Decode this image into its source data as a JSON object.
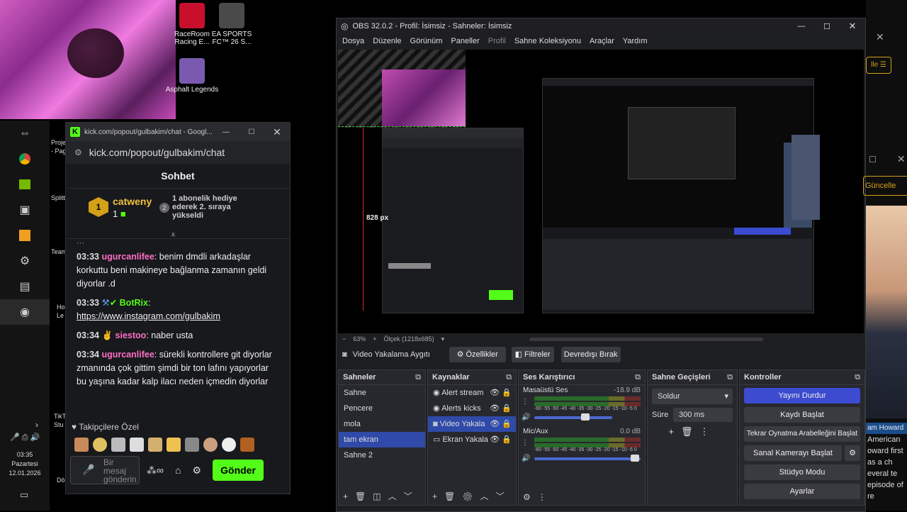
{
  "desktop": {
    "icons": [
      {
        "label": "RaceRoom Racing E...",
        "color": "#c8102e"
      },
      {
        "label": "EA SPORTS FC™ 26 S...",
        "color": "#4a4a4a"
      },
      {
        "label": "Asphalt Legends",
        "color": "#7a5ab0"
      }
    ],
    "partial_labels": [
      "Proje",
      "- Pag",
      "Splitt",
      "Team",
      "Ho",
      "Le",
      "TikT",
      "Stu",
      "Dö"
    ],
    "clock": {
      "time": "03:35",
      "day": "Pazartesi",
      "date": "12.01.2026"
    }
  },
  "kick": {
    "title": "kick.com/popout/gulbakim/chat - Googl...",
    "url": "kick.com/popout/gulbakim/chat",
    "header": "Sohbet",
    "pinned": {
      "user": "catweny",
      "count": "1",
      "message": "1 abonelik hediye ederek 2. sıraya yükseldi"
    },
    "messages": [
      {
        "time": "03:33",
        "user": "ugurcanlifee",
        "text": ": benim dmdli arkadaşlar korkuttu beni makineye bağlanma zamanın geldi diyorlar .d",
        "style": "pink"
      },
      {
        "time": "03:33",
        "user": "BotRix",
        "text": ":",
        "link": "https://www.instagram.com/gulbakim",
        "style": "green"
      },
      {
        "time": "03:34",
        "user": "siestoo",
        "text": ": naber usta",
        "style": "pink"
      },
      {
        "time": "03:34",
        "user": "ugurcanlifee",
        "text": ": sürekli kontrollere git diyorlar zmanında çok gittim şimdi bir ton lafını yapıyorlar bu yaşına kadar kalp ilacı neden içmedin diyorlar",
        "style": "pink"
      }
    ],
    "followers_label": "Takipçilere Özel",
    "input_placeholder": "Bir mesaj gönderin",
    "send_label": "Gönder"
  },
  "obs": {
    "title": "OBS 32.0.2 - Profil: İsimsiz - Sahneler: İsimsiz",
    "menu": [
      "Dosya",
      "Düzenle",
      "Görünüm",
      "Paneller",
      "Profil",
      "Sahne Koleksiyonu",
      "Araçlar",
      "Yardım"
    ],
    "preview_label": "828 px",
    "zoom": "63%",
    "scale": "Ölçek (1218x685)",
    "source_bar": {
      "name": "Video Yakalama Aygıtı",
      "props": "Özellikler",
      "filters": "Filtreler",
      "deactivate": "Devredışı Bırak"
    },
    "scenes": {
      "title": "Sahneler",
      "items": [
        "Sahne",
        "Pencere",
        "mola",
        "tam ekran",
        "Sahne 2"
      ],
      "selected": 3
    },
    "sources": {
      "title": "Kaynaklar",
      "items": [
        "Alert stream",
        "Alerts kicks",
        "Video Yakala",
        "Ekran Yakala"
      ],
      "selected": 2
    },
    "mixer": {
      "title": "Ses Karıştırıcı",
      "channels": [
        {
          "name": "Masaüstü Ses",
          "db": "-18.9 dB"
        },
        {
          "name": "Mic/Aux",
          "db": "0.0 dB"
        }
      ],
      "scale": "-60 -55 -50 -45 -40 -35 -30 -25 -20 -15 -10 -5 0"
    },
    "transitions": {
      "title": "Sahne Geçişleri",
      "type": "Soldur",
      "duration_label": "Süre",
      "duration": "300 ms"
    },
    "controls": {
      "title": "Kontroller",
      "buttons": [
        "Yayını Durdur",
        "Kaydı Başlat",
        "Tekrar Oynatma Arabelleğini Başlat",
        "Sanal Kamerayı Başlat",
        "Stüdyo Modu",
        "Ayarlar"
      ]
    }
  },
  "right": {
    "update_label": "Güncelle",
    "name_tag": "am Howard",
    "caption": "American oward first as a ch everal te episode of re"
  }
}
